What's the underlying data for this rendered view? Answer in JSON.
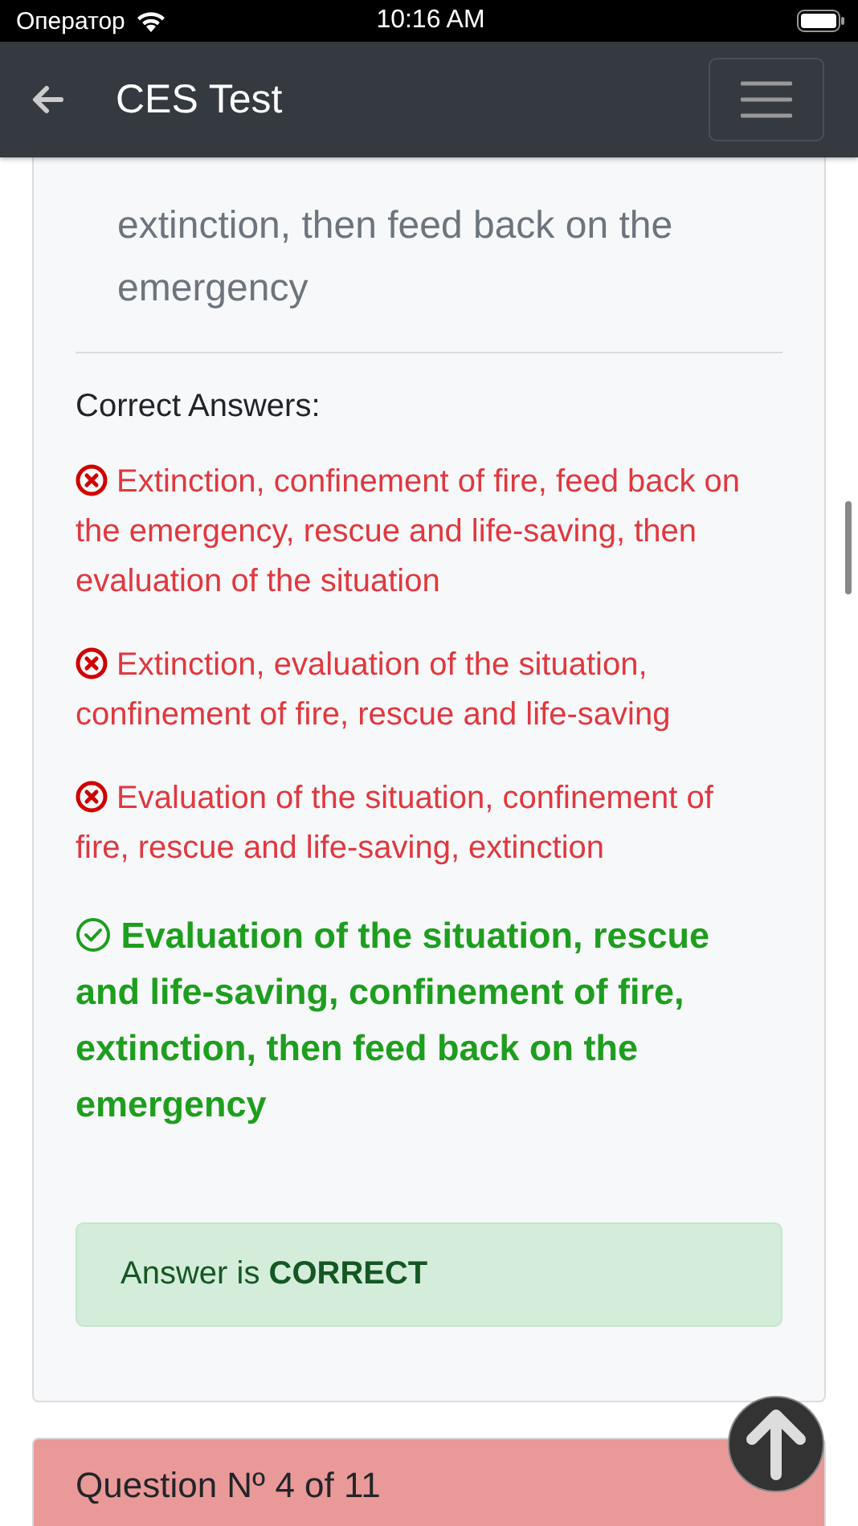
{
  "status_bar": {
    "carrier": "Оператор",
    "time": "10:16 AM"
  },
  "navbar": {
    "title": "CES Test"
  },
  "question_card": {
    "question_text": "extinction, then feed back on the emergency",
    "answers_heading": "Correct Answers:",
    "answers": [
      {
        "text": "Extinction, confinement of fire, feed back on the emergency, rescue and life-saving, then evaluation of the situation",
        "correct": false
      },
      {
        "text": "Extinction, evaluation of the situation, confinement of fire, rescue and life-saving",
        "correct": false
      },
      {
        "text": "Evaluation of the situation, confinement of fire, rescue and life-saving, extinction",
        "correct": false
      },
      {
        "text": "Evaluation of the situation, rescue and life-saving, confinement of fire, extinction, then feed back on the emergency",
        "correct": true
      }
    ],
    "result": {
      "text": "Answer is **CORRECT**",
      "correct": true
    }
  },
  "next_question": {
    "title": "Question Nº 4 of 11"
  }
}
